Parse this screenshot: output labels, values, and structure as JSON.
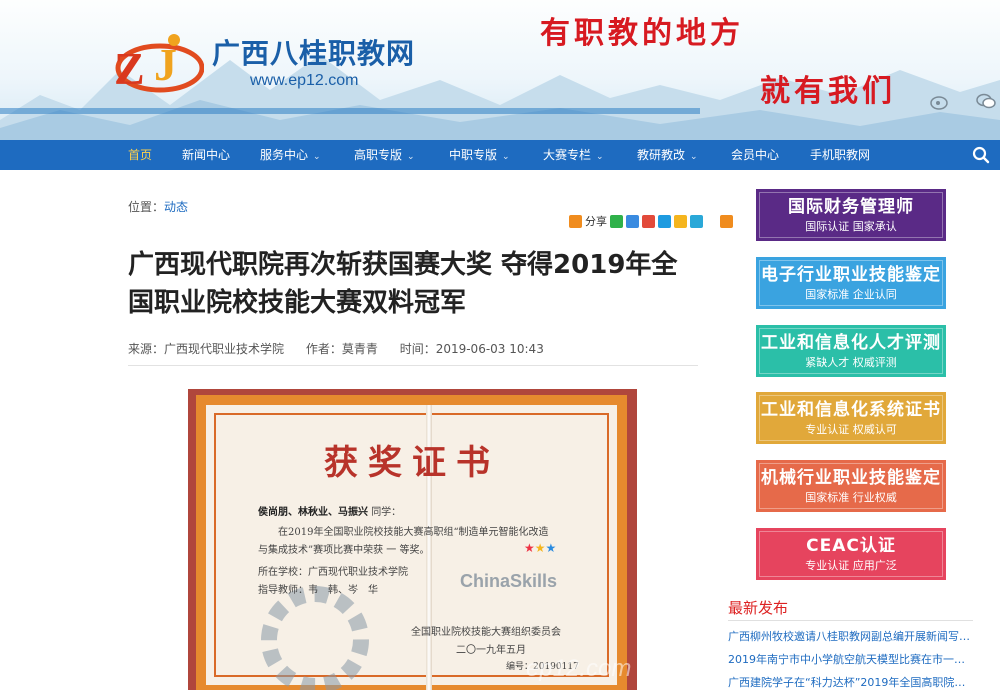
{
  "site": {
    "name": "广西八桂职教网",
    "url": "www.ep12.com",
    "logo_text": "ZJ",
    "slogan_line1": "有职教的地方",
    "slogan_line2": "就有我们"
  },
  "nav": {
    "items": [
      {
        "label": "首页",
        "active": true,
        "dropdown": false
      },
      {
        "label": "新闻中心",
        "dropdown": false
      },
      {
        "label": "服务中心",
        "dropdown": true
      },
      {
        "label": "高职专版",
        "dropdown": true
      },
      {
        "label": "中职专版",
        "dropdown": true
      },
      {
        "label": "大赛专栏",
        "dropdown": true
      },
      {
        "label": "教研教改",
        "dropdown": true
      },
      {
        "label": "会员中心",
        "dropdown": false
      },
      {
        "label": "手机职教网",
        "dropdown": false
      }
    ],
    "search_icon": "search-icon"
  },
  "breadcrumb": {
    "prefix": "位置：",
    "link": "动态"
  },
  "share": {
    "label": "分享"
  },
  "article": {
    "title": "广西现代职院再次斩获国赛大奖 夺得2019年全国职业院校技能大赛双料冠军",
    "source": "来源：广西现代职业技术学院",
    "author": "作者：莫青青",
    "time": "时间：2019-06-03 10:43"
  },
  "certificate": {
    "title": "获奖证书",
    "names": "侯尚朋、林秋业、马振兴",
    "greeting": "同学：",
    "body_line1": "在2019年全国职业院校技能大赛高职组“制造单元智能化改造",
    "body_line2": "与集成技术”赛项比赛中荣获 一 等奖。",
    "school": "所在学校：广西现代职业技术学院",
    "advisor": "指导教师：韦　韩、岑　华",
    "issuer": "全国职业院校技能大赛组织委员会",
    "date": "二〇一九年五月",
    "serial": "编号：20190117",
    "logo": "ChinaSkills",
    "watermark": "ep12.com"
  },
  "sidebar_ads": [
    {
      "title": "国际财务管理师",
      "subtitle": "国际认证 国家承认",
      "color": "#5a2a86"
    },
    {
      "title": "电子行业职业技能鉴定",
      "subtitle": "国家标准 企业认同",
      "color": "#3aa3e0"
    },
    {
      "title": "工业和信息化人才评测",
      "subtitle": "紧缺人才 权威评测",
      "color": "#2bbfa8"
    },
    {
      "title": "工业和信息化系统证书",
      "subtitle": "专业认证 权威认可",
      "color": "#e1a83a"
    },
    {
      "title": "机械行业职业技能鉴定",
      "subtitle": "国家标准 行业权威",
      "color": "#e66a4a"
    },
    {
      "title": "CEAC认证",
      "subtitle": "专业认证 应用广泛",
      "color": "#e6445e"
    }
  ],
  "latest": {
    "heading": "最新发布",
    "items": [
      "广西柳州牧校邀请八桂职教网副总编开展新闻写作…",
      "2019年南宁市中小学航空航天模型比赛在市一职校…",
      "广西建院学子在“科力达杯”2019年全国高职院校…"
    ]
  }
}
